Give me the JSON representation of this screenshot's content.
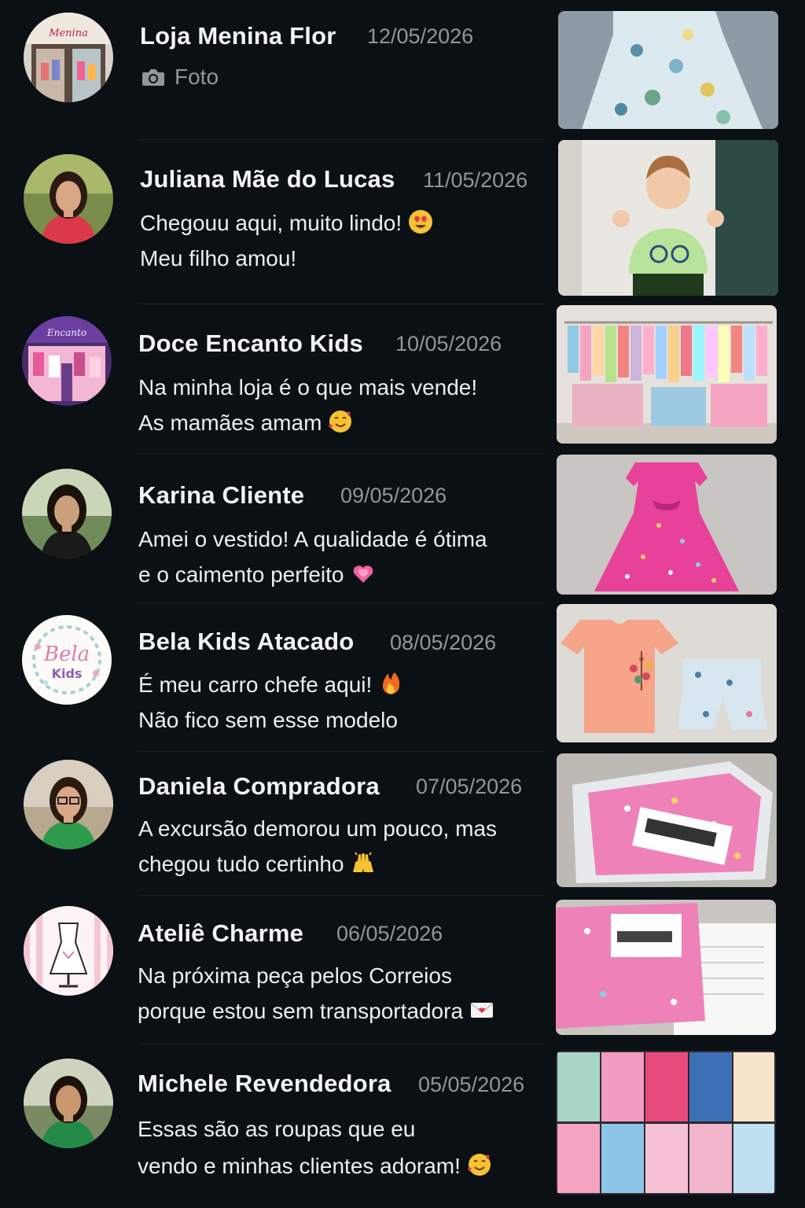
{
  "chats": [
    {
      "name": "Loja Menina Flor",
      "date": "12/05/2026",
      "avatar": "store-front-avatar",
      "photo_label": "Foto",
      "lines": [],
      "thumbnail": "floral-dress-thumbnail"
    },
    {
      "name": "Juliana Mãe do Lucas",
      "date": "11/05/2026",
      "avatar": "woman-avatar",
      "lines": [
        "Chegouu aqui, muito lindo!",
        "Meu filho amou!"
      ],
      "emoji": "heart-eyes-emoji",
      "thumbnail": "boy-thumbs-up-thumbnail"
    },
    {
      "name": "Doce Encanto Kids",
      "date": "10/05/2026",
      "avatar": "pink-store-avatar",
      "lines": [
        "Na minha loja é o que mais vende!",
        "As mamães amam"
      ],
      "emoji": "smiling-hearts-emoji",
      "thumbnail": "clothing-rack-thumbnail"
    },
    {
      "name": "Karina Cliente",
      "date": "09/05/2026",
      "avatar": "woman-avatar",
      "lines": [
        "Amei o vestido! A qualidade é ótima",
        "e o caimento perfeito"
      ],
      "emoji": "sparkling-heart-emoji",
      "thumbnail": "pink-dress-thumbnail"
    },
    {
      "name": "Bela Kids Atacado",
      "date": "08/05/2026",
      "avatar": "bela-kids-logo-avatar",
      "avatar_text": [
        "Bela",
        "Kids"
      ],
      "lines": [
        "É meu carro chefe aqui!",
        "Não fico sem esse modelo"
      ],
      "emoji": "fire-emoji",
      "thumbnail": "shirt-shorts-set-thumbnail"
    },
    {
      "name": "Daniela Compradora",
      "date": "07/05/2026",
      "avatar": "woman-avatar",
      "lines": [
        "A excursão demorou um pouco, mas",
        "chegou tudo certinho"
      ],
      "emoji": "raising-hands-emoji",
      "thumbnail": "package-bag-thumbnail"
    },
    {
      "name": "Ateliê Charme",
      "date": "06/05/2026",
      "avatar": "dress-form-avatar",
      "lines": [
        "Na próxima peça pelos Correios",
        "porque estou sem transportadora"
      ],
      "emoji": "envelope-emoji",
      "thumbnail": "pink-package-thumbnail"
    },
    {
      "name": "Michele Revendedora",
      "date": "05/05/2026",
      "avatar": "woman-avatar",
      "lines": [
        "Essas são as roupas que eu",
        "vendo e minhas clientes adoram!"
      ],
      "emoji": "smiling-hearts-emoji",
      "thumbnail": "dress-collage-thumbnail"
    }
  ],
  "colors": {
    "background": "#0b1014",
    "name": "#f2f4f5",
    "date": "#8f979d",
    "message": "#eceff1"
  }
}
